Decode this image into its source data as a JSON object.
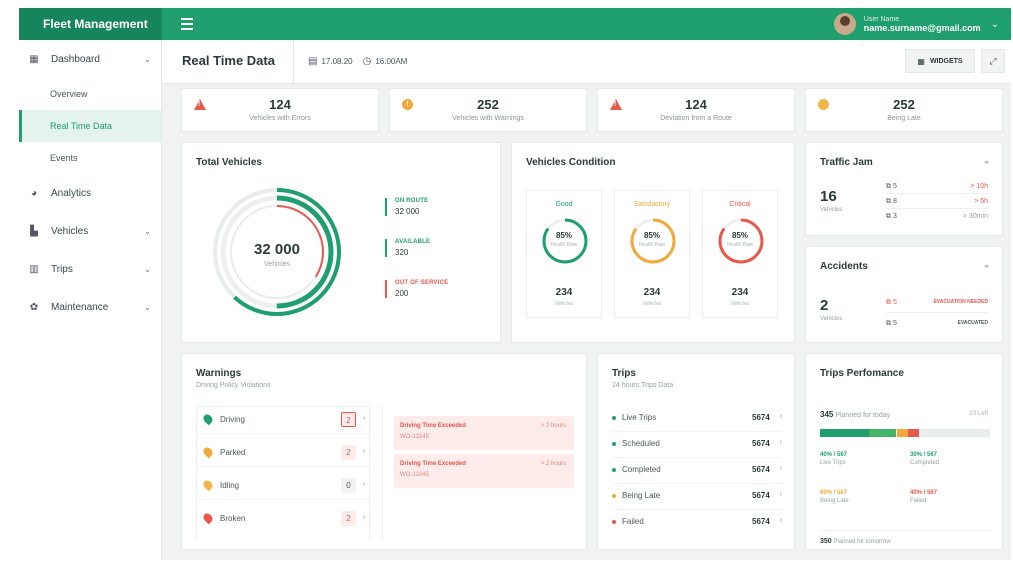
{
  "brand": "Fleet Management",
  "user": {
    "label": "User Name",
    "email": "name.surname@gmail.com"
  },
  "sidebar": {
    "items": [
      {
        "label": "Dashboard",
        "icon": "dashboard-icon"
      },
      {
        "label": "Analytics",
        "icon": "pie-chart-icon"
      },
      {
        "label": "Vehicles",
        "icon": "truck-icon"
      },
      {
        "label": "Trips",
        "icon": "bar-chart-icon"
      },
      {
        "label": "Maintenance",
        "icon": "gear-icon"
      }
    ],
    "subitems": [
      {
        "label": "Overview"
      },
      {
        "label": "Real Time Data"
      },
      {
        "label": "Events"
      }
    ]
  },
  "header": {
    "title": "Real Time Data",
    "date": "17.08.20",
    "time": "16:00AM",
    "widgets": "WIDGETS"
  },
  "stats": [
    {
      "value": "124",
      "label": "Vehicles with Errors"
    },
    {
      "value": "252",
      "label": "Vehicles with Warnings"
    },
    {
      "value": "124",
      "label": "Deviation from a Route"
    },
    {
      "value": "252",
      "label": "Being Late"
    }
  ],
  "total": {
    "title": "Total Vehicles",
    "value": "32 000",
    "unit": "Vehicles",
    "legend": [
      {
        "label": "ON ROUTE",
        "value": "32 000",
        "color": "#1f9e6e"
      },
      {
        "label": "AVAILABLE",
        "value": "320",
        "color": "#1f9e6e"
      },
      {
        "label": "OUT OF SERVICE",
        "value": "200",
        "color": "#e8584d"
      }
    ],
    "rings": {
      "on_route_fraction": 0.62,
      "available_fraction": 0.5,
      "out_fraction": 0.34
    }
  },
  "condition": {
    "title": "Vehicles Condition",
    "cols": [
      {
        "name": "Good",
        "pct": "85%",
        "pct_label": "Health Rate",
        "count": "234",
        "count_label": "Vehicles",
        "color": "#1f9e6e",
        "fraction": 0.85
      },
      {
        "name": "Satisfactory",
        "pct": "85%",
        "pct_label": "Health Rate",
        "count": "234",
        "count_label": "Vehicles",
        "color": "#f2a93b",
        "fraction": 0.85
      },
      {
        "name": "Critical",
        "pct": "85%",
        "pct_label": "Health Rate",
        "count": "234",
        "count_label": "Vehicles",
        "color": "#e8584d",
        "fraction": 0.85
      }
    ]
  },
  "traffic": {
    "title": "Traffic Jam",
    "value": "16",
    "unit": "Vehicles",
    "rows": [
      {
        "a": "5",
        "b": "> 10h"
      },
      {
        "a": "8",
        "b": "> 5h"
      },
      {
        "a": "3",
        "b": "> 30min"
      }
    ]
  },
  "accidents": {
    "title": "Accidents",
    "value": "2",
    "unit": "Vehicles",
    "rows": [
      {
        "a": "5",
        "b": "EVACUATION NEEDED",
        "color": "#e8584d"
      },
      {
        "a": "5",
        "b": "EVACUATED",
        "color": "#4a5859"
      }
    ]
  },
  "warnings": {
    "title": "Warnings",
    "subtitle": "Driving Policy Violations",
    "rows": [
      {
        "name": "Driving",
        "count": "2",
        "color": "#1f9e6e"
      },
      {
        "name": "Parked",
        "count": "2",
        "color": "#f2a93b"
      },
      {
        "name": "Idling",
        "count": "0",
        "color": "#f2b54a"
      },
      {
        "name": "Broken",
        "count": "2",
        "color": "#e8584d"
      }
    ],
    "alerts": [
      {
        "title": "Driving Time Exceeded",
        "hours": "> 2 hours",
        "id": "WO-13245"
      },
      {
        "title": "Driving Time Exceeded",
        "hours": "> 2 hours",
        "id": "WO-13245"
      }
    ]
  },
  "trips": {
    "title": "Trips",
    "subtitle": "24 hours Trips Data",
    "rows": [
      {
        "name": "Live Trips",
        "value": "5674",
        "color": "#1f9e6e"
      },
      {
        "name": "Scheduled",
        "value": "5674",
        "color": "#1f9e6e"
      },
      {
        "name": "Completed",
        "value": "5674",
        "color": "#1f9e6e"
      },
      {
        "name": "Being Late",
        "value": "5674",
        "color": "#f2a93b"
      },
      {
        "name": "Failed",
        "value": "5674",
        "color": "#e8584d"
      }
    ]
  },
  "performance": {
    "title": "Trips Perfomance",
    "planned_today_value": "345",
    "planned_today_label": "Planned for today",
    "left": "23 Left",
    "segments": [
      {
        "color": "#1f9e6e",
        "fraction": 0.29
      },
      {
        "color": "#46b36a",
        "fraction": 0.16
      },
      {
        "color": "#f2a93b",
        "fraction": 0.07
      },
      {
        "color": "#e8584d",
        "fraction": 0.06
      }
    ],
    "stats": [
      {
        "a": "40% / 567",
        "b": "Live Trips",
        "color": "#1f9e6e"
      },
      {
        "a": "30% / 567",
        "b": "Completed",
        "color": "#1f9e6e"
      },
      {
        "a": "60% / 567",
        "b": "Being Late",
        "color": "#f2a93b"
      },
      {
        "a": "40% / 567",
        "b": "Failed",
        "color": "#e8584d"
      }
    ],
    "planned_tomorrow_value": "350",
    "planned_tomorrow_label": "Planned for tomorrow"
  }
}
